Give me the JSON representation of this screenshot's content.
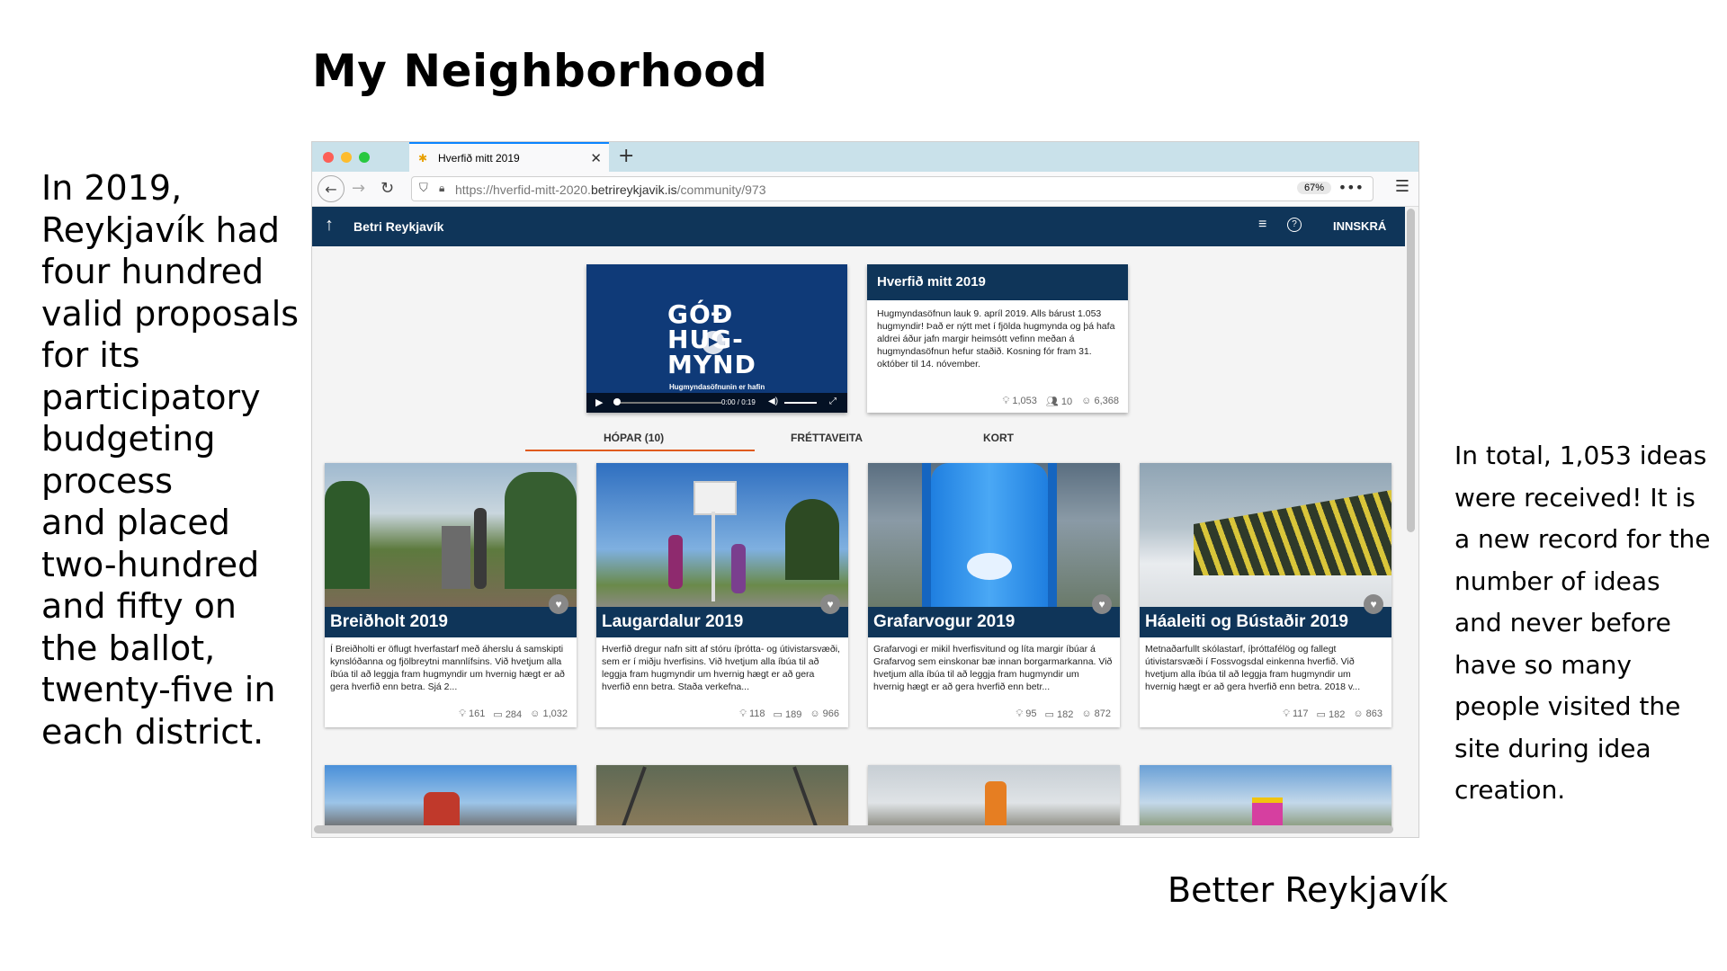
{
  "slide": {
    "title": "My Neighborhood",
    "left_text": "In 2019,\nReykjavík had\nfour hundred\nvalid proposals\nfor its\nparticipatory\nbudgeting\nprocess\nand placed\ntwo-hundred\nand fifty on\nthe ballot,\ntwenty-five in\neach district.",
    "right_text": "In total, 1,053 ideas were received! It is a new record for the number of ideas and never before have so many people visited the site during idea creation.",
    "caption": "Better Reykjavík"
  },
  "browser": {
    "tab_title": "Hverfið mitt 2019",
    "tab_close": "✕",
    "new_tab": "+",
    "url_host_prefix": "https://hverfid-mitt-2020.",
    "url_host_main": "betrireykjavik.is",
    "url_path": "/community/973",
    "zoom": "67%",
    "more": "•••",
    "menu": "☰"
  },
  "app": {
    "brand": "Betri Reykjavík",
    "login": "INNSKRÁ",
    "video": {
      "lines": [
        "GÓÐ",
        "HUG-",
        "MYND"
      ],
      "subtitle": "Hugmyndasöfnunin er hafin",
      "time": "0:00 / 0:19"
    },
    "info": {
      "title": "Hverfið mitt 2019",
      "body": "Hugmyndasöfnun lauk 9. apríl 2019. Alls bárust 1.053 hugmyndir! Það er nýtt met í fjölda hugmynda og þá hafa aldrei áður jafn margir heimsótt vefinn meðan á hugmyndasöfnun hefur staðið. Kosning fór fram 31. október til 14. nóvember.",
      "ideas": "1,053",
      "groups": "10",
      "users": "6,368"
    },
    "tabs": [
      "HÓPAR  (10)",
      "FRÉTTAVEITA",
      "KORT"
    ],
    "cards": [
      {
        "title": "Breiðholt 2019",
        "desc": "Í Breiðholti er öflugt hverfastarf með áherslu á samskipti kynslóðanna og fjölbreytni mannlífsins. Við hvetjum alla íbúa til að leggja fram hugmyndir um hvernig hægt er að gera hverfið enn betra. Sjá 2...",
        "ideas": "161",
        "comments": "284",
        "users": "1,032"
      },
      {
        "title": "Laugardalur 2019",
        "desc": "Hverfið dregur nafn sitt af stóru íþrótta- og útivistarsvæði, sem er í miðju hverfisins. Við hvetjum alla íbúa til að leggja fram hugmyndir um hvernig hægt er að gera hverfið enn betra. Staða verkefna...",
        "ideas": "118",
        "comments": "189",
        "users": "966"
      },
      {
        "title": "Grafarvogur 2019",
        "desc": "Grafarvogi er mikil hverfisvitund og líta margir íbúar á Grafarvog sem einskonar bæ innan borgarmarkanna. Við hvetjum alla íbúa til að leggja fram hugmyndir um hvernig hægt er að gera hverfið enn betr...",
        "ideas": "95",
        "comments": "182",
        "users": "872"
      },
      {
        "title": "Háaleiti og Bústaðir 2019",
        "desc": "Metnaðarfullt skólastarf, íþróttafélög og fallegt útivistarsvæði í Fossvogsdal einkenna hverfið. Við hvetjum alla íbúa til að leggja fram hugmyndir um hvernig hægt er að gera hverfið enn betra. 2018 v...",
        "ideas": "117",
        "comments": "182",
        "users": "863"
      }
    ]
  },
  "colors": {
    "navy": "#0f3559",
    "accent_orange": "#e05a1e",
    "tabbar": "#c9e1ea",
    "active_tab_border": "#0a84ff"
  },
  "icons": [
    "back-arrow-icon",
    "forward-arrow-icon",
    "reload-icon",
    "shield-icon",
    "lock-icon",
    "menu-icon",
    "help-icon",
    "heart-icon",
    "lightbulb-icon",
    "comment-icon",
    "people-icon",
    "user-icon",
    "play-icon"
  ]
}
